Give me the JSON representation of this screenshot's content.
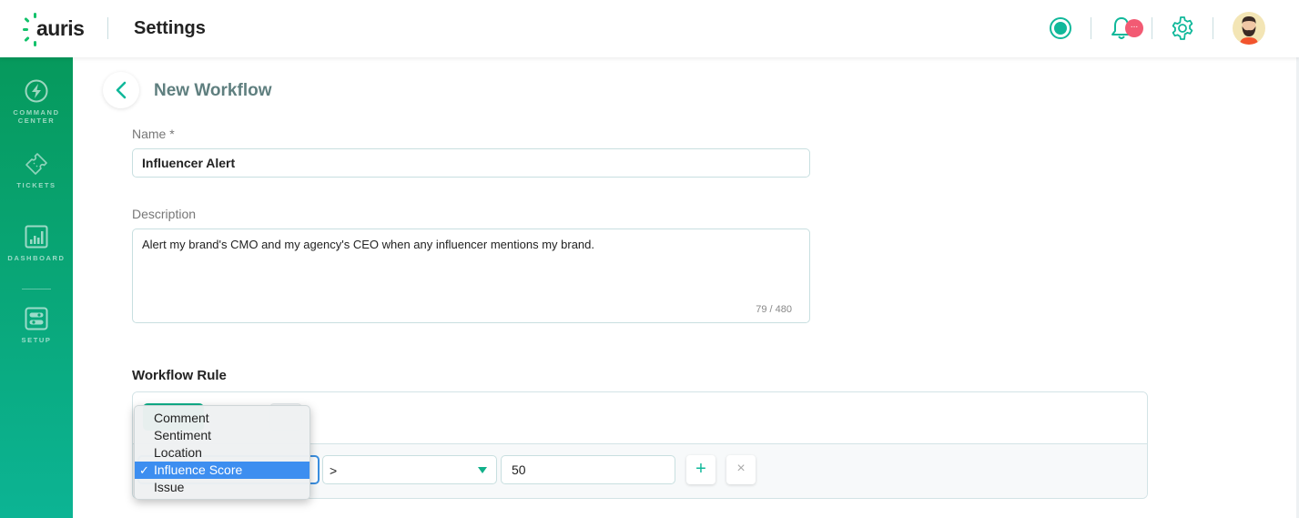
{
  "header": {
    "logo_text": "auris",
    "page_title": "Settings",
    "notification_badge": "...",
    "status_icon": "status-indicator-icon",
    "bell_icon": "bell-icon",
    "gear_icon": "gear-icon",
    "avatar_icon": "user-avatar"
  },
  "sidebar": {
    "items": [
      {
        "label_line1": "COMMAND",
        "label_line2": "CENTER",
        "icon": "lightning-icon"
      },
      {
        "label_line1": "TICKETS",
        "icon": "ticket-icon"
      },
      {
        "label_line1": "DASHBOARD",
        "icon": "bar-chart-icon"
      },
      {
        "label_line1": "SETUP",
        "icon": "toggles-icon"
      }
    ]
  },
  "workflow": {
    "title": "New Workflow",
    "name_label": "Name *",
    "name_value": "Influencer Alert",
    "description_label": "Description",
    "description_value": "Alert my brand's CMO and my agency's CEO when any influencer mentions my brand.",
    "char_count": "79 / 480"
  },
  "rule": {
    "title": "Workflow Rule",
    "operator_value": ">",
    "threshold_value": "50",
    "add_label": "+",
    "remove_label": "×"
  },
  "dropdown": {
    "options": [
      {
        "label": "Comment",
        "selected": false
      },
      {
        "label": "Sentiment",
        "selected": false
      },
      {
        "label": "Location",
        "selected": false
      },
      {
        "label": "Influence Score",
        "selected": true
      },
      {
        "label": "Issue",
        "selected": false
      }
    ],
    "check_mark": "✓"
  },
  "colors": {
    "brand_green": "#06995c",
    "brand_teal": "#10b89a",
    "badge_red": "#f25a73",
    "selection_blue": "#3d8ef0"
  }
}
